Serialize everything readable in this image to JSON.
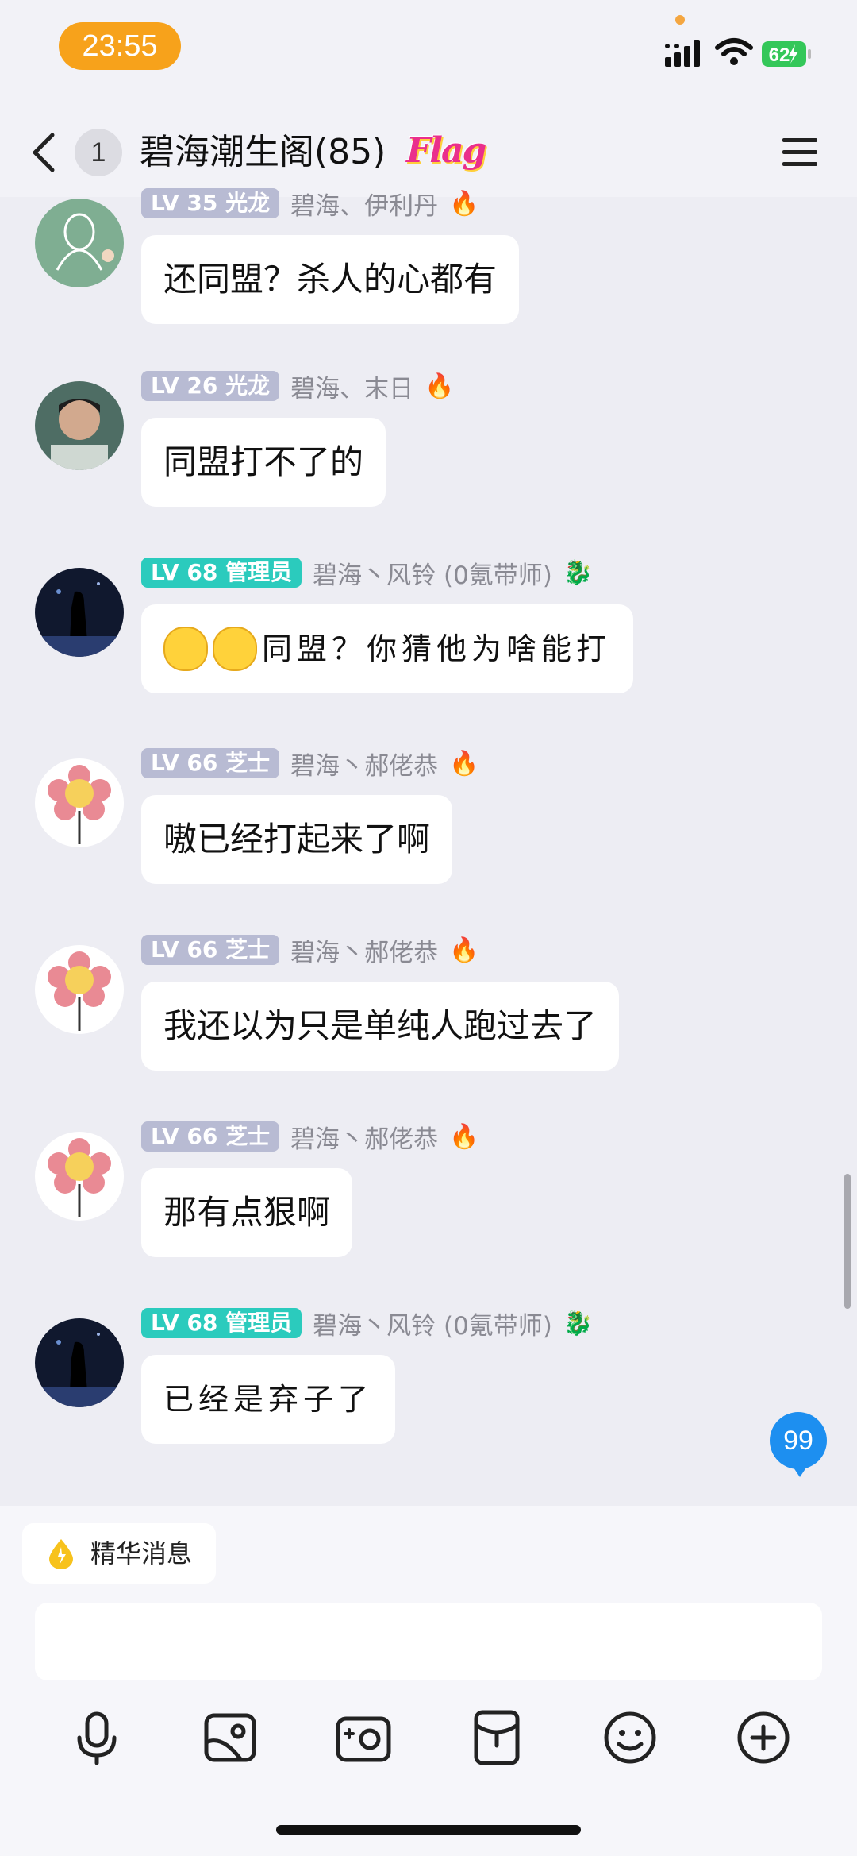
{
  "status_bar": {
    "time": "23:55",
    "battery": "62"
  },
  "header": {
    "unread_count": "1",
    "title": "碧海潮生阁(85)",
    "flag_badge": "Flag"
  },
  "messages": [
    {
      "level": "LV 35",
      "title_tag": "光龙",
      "sender": "碧海、伊利丹",
      "badge": "🔥",
      "text": "还同盟？杀人的心都有"
    },
    {
      "level": "LV 26",
      "title_tag": "光龙",
      "sender": "碧海、末日",
      "badge": "🔥",
      "text": "同盟打不了的"
    },
    {
      "level": "LV 68",
      "title_tag": "管理员",
      "sender": "碧海丶风铃 (0氪带师)",
      "badge": "🐉",
      "text": "同盟？你猜他为啥能打"
    },
    {
      "level": "LV 66",
      "title_tag": "芝士",
      "sender": "碧海丶郝佬恭",
      "badge": "🔥",
      "text": "嗷已经打起来了啊"
    },
    {
      "level": "LV 66",
      "title_tag": "芝士",
      "sender": "碧海丶郝佬恭",
      "badge": "🔥",
      "text": "我还以为只是单纯人跑过去了"
    },
    {
      "level": "LV 66",
      "title_tag": "芝士",
      "sender": "碧海丶郝佬恭",
      "badge": "🔥",
      "text": "那有点狠啊"
    },
    {
      "level": "LV 68",
      "title_tag": "管理员",
      "sender": "碧海丶风铃 (0氪带师)",
      "badge": "🐉",
      "text": "已经是弃子了"
    }
  ],
  "unread_bubble": "99",
  "essence_label": "精华消息",
  "toolbar": [
    "microphone-icon",
    "image-icon",
    "camera-icon",
    "red-packet-icon",
    "emoji-icon",
    "plus-icon"
  ]
}
